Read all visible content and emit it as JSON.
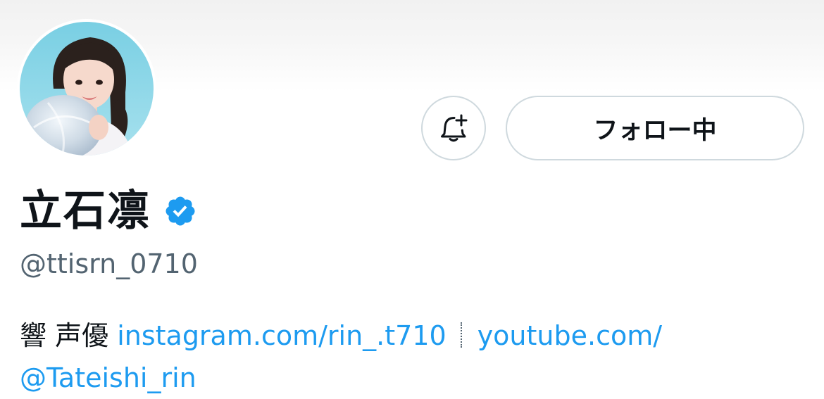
{
  "profile": {
    "display_name": "立石凛",
    "verified_icon": "verified-badge-icon",
    "handle": "@ttisrn_0710",
    "bio": {
      "prefix": "響 声優",
      "link1": "instagram.com/rin_.t710",
      "link2": "youtube.com/",
      "link3": "@Tateishi_rin"
    }
  },
  "actions": {
    "notify_icon": "bell-plus-icon",
    "follow_label": "フォロー中"
  },
  "colors": {
    "link": "#1d9bf0",
    "verified": "#1d9bf0",
    "secondary_text": "#536471",
    "border": "#cfd9de"
  }
}
